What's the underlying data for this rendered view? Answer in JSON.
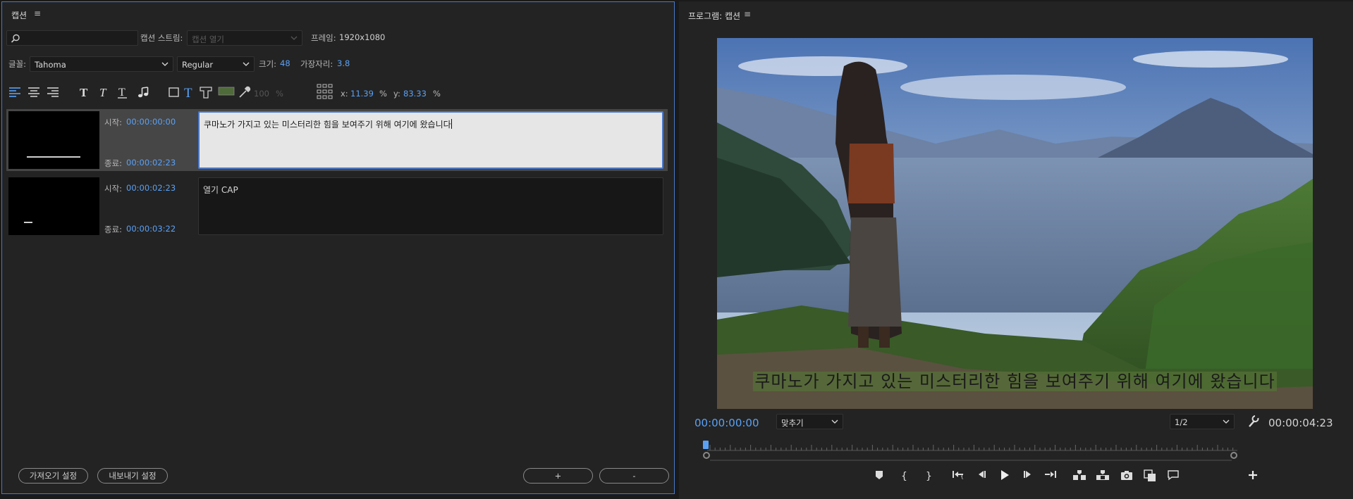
{
  "captions_panel": {
    "title": "캡션",
    "search": {
      "value": "",
      "placeholder": ""
    },
    "caption_stream_label": "캡션 스트림:",
    "caption_stream_value": "캡션 열기",
    "frame_label": "프레임:",
    "frame_value": "1920x1080",
    "font_label": "글꼴:",
    "font_value": "Tahoma",
    "style_value": "Regular",
    "size_label": "크기:",
    "size_value": "48",
    "edge_label": "가장자리:",
    "edge_value": "3.8",
    "opacity_value": "100",
    "percent": "%",
    "x_label": "x:",
    "x_value": "11.39",
    "y_label": "y:",
    "y_value": "83.33",
    "captions": [
      {
        "start_label": "시작:",
        "start": "00:00:00:00",
        "end_label": "종료:",
        "end": "00:00:02:23",
        "text": "쿠마노가 가지고 있는 미스터리한 힘을 보여주기 위해 여기에 왔습니다",
        "selected": true
      },
      {
        "start_label": "시작:",
        "start": "00:00:02:23",
        "end_label": "종료:",
        "end": "00:00:03:22",
        "text": "열기 CAP",
        "selected": false
      }
    ],
    "import_settings_label": "가져오기 설정",
    "export_settings_label": "내보내기 설정",
    "add_label": "+",
    "remove_label": "-",
    "accent_color": "#5aa1f5"
  },
  "program_monitor": {
    "title": "프로그램: 캡션",
    "subtitle_overlay": "쿠마노가 가지고 있는 미스터리한 힘을 보여주기 위해 여기에 왔습니다",
    "current_timecode": "00:00:00:00",
    "fit_value": "맞추기",
    "resolution_value": "1/2",
    "duration_timecode": "00:00:04:23"
  }
}
